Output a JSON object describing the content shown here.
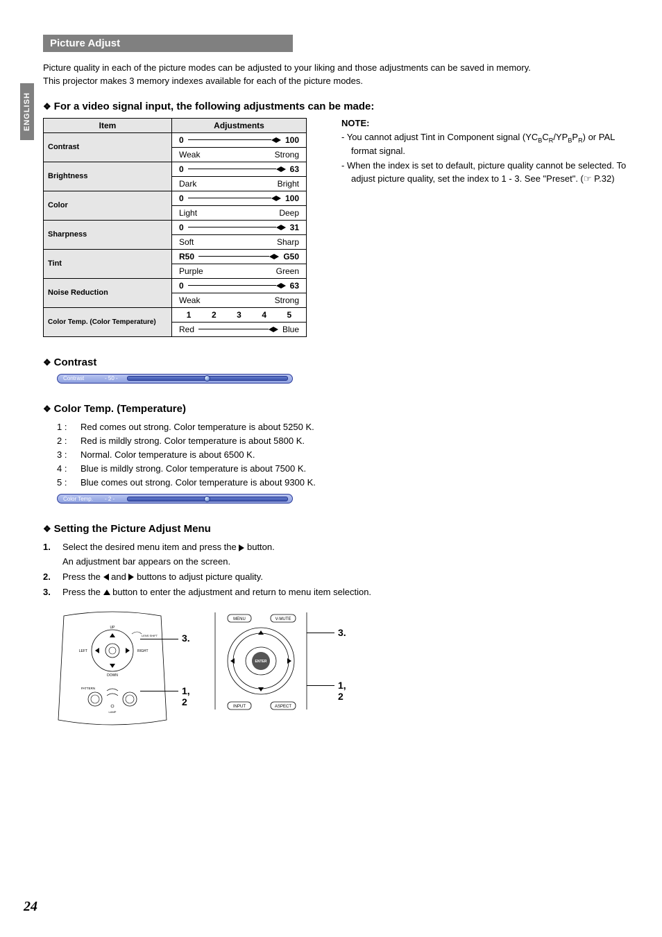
{
  "sideTab": "ENGLISH",
  "sectionTitle": "Picture Adjust",
  "intro1": "Picture quality in each of the picture modes can be adjusted to your liking and those adjustments can be saved in memory.",
  "intro2": "This projector makes 3 memory indexes available for each of the picture modes.",
  "heading1": "For a video signal input, the following adjustments can be made:",
  "tableHeaders": {
    "item": "Item",
    "adj": "Adjustments"
  },
  "adjustments": [
    {
      "item": "Contrast",
      "min": "0",
      "max": "100",
      "minLabel": "Weak",
      "maxLabel": "Strong"
    },
    {
      "item": "Brightness",
      "min": "0",
      "max": "63",
      "minLabel": "Dark",
      "maxLabel": "Bright"
    },
    {
      "item": "Color",
      "min": "0",
      "max": "100",
      "minLabel": "Light",
      "maxLabel": "Deep"
    },
    {
      "item": "Sharpness",
      "min": "0",
      "max": "31",
      "minLabel": "Soft",
      "maxLabel": "Sharp"
    },
    {
      "item": "Tint",
      "min": "R50",
      "max": "G50",
      "minLabel": "Purple",
      "maxLabel": "Green"
    },
    {
      "item": "Noise Reduction",
      "min": "0",
      "max": "63",
      "minLabel": "Weak",
      "maxLabel": "Strong"
    }
  ],
  "colorTempRow": {
    "item": "Color Temp. (Color Temperature)",
    "steps": [
      "1",
      "2",
      "3",
      "4",
      "5"
    ],
    "minLabel": "Red",
    "maxLabel": "Blue"
  },
  "note": {
    "title": "NOTE:",
    "items": [
      "You cannot adjust Tint in Component signal (YCBCR/YPBPR) or PAL format signal.",
      "When the index is set to default, picture quality cannot be selected. To adjust picture quality, set the index to 1 - 3. See \"Preset\". (☞ P.32)"
    ]
  },
  "contrastSection": {
    "title": "Contrast",
    "osdLabel": "Contrast",
    "osdValue": "- 50 -"
  },
  "colorTempSection": {
    "title": "Color Temp. (Temperature)",
    "osdLabel": "Color Temp.",
    "osdValue": "- 2 -",
    "list": [
      {
        "n": "1 :",
        "t": "Red comes out strong. Color temperature is about 5250 K."
      },
      {
        "n": "2 :",
        "t": "Red is mildly strong. Color temperature is about 5800 K."
      },
      {
        "n": "3 :",
        "t": "Normal. Color temperature is about 6500 K."
      },
      {
        "n": "4 :",
        "t": "Blue is mildly strong. Color temperature is about 7500 K."
      },
      {
        "n": "5 :",
        "t": "Blue comes out strong. Color temperature is about 9300 K."
      }
    ]
  },
  "settingSection": {
    "title": "Setting the Picture Adjust Menu",
    "steps": [
      {
        "a": "Select the desired menu item and press the ",
        "b": " button.",
        "sub": "An adjustment bar appears on the screen."
      },
      {
        "a": "Press the ",
        "mid": " and ",
        "b": " buttons to adjust picture quality."
      },
      {
        "a": "Press the ",
        "b": " button to enter the adjustment and return to menu item selection."
      }
    ]
  },
  "diagramCallouts": {
    "proj3": "3.",
    "proj12": "1, 2",
    "rem3": "3.",
    "rem12": "1, 2"
  },
  "remoteButtons": {
    "menu": "MENU",
    "vmute": "V-MUTE",
    "enter": "ENTER",
    "input": "INPUT",
    "aspect": "ASPECT"
  },
  "projLabels": {
    "up": "UP",
    "down": "DOWN",
    "left": "LEFT",
    "right": "RIGHT",
    "lensShift": "LENS SHIFT",
    "pattern": "PATTERN",
    "lamp": "LAMP"
  },
  "pageNum": "24"
}
